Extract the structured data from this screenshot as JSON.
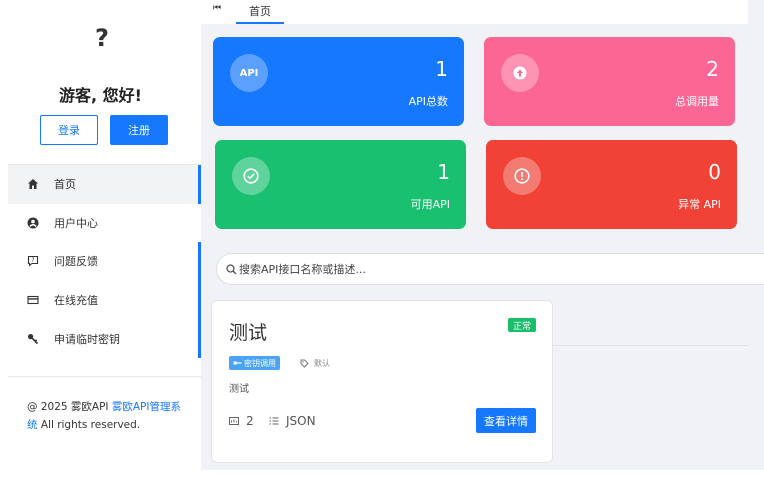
{
  "sidebar": {
    "avatar": "?",
    "greeting": "游客, 您好!",
    "login_label": "登录",
    "register_label": "注册",
    "items": [
      {
        "label": "首页",
        "icon": "home-icon"
      },
      {
        "label": "用户中心",
        "icon": "user-icon"
      },
      {
        "label": "问题反馈",
        "icon": "feedback-icon"
      },
      {
        "label": "在线充值",
        "icon": "card-icon"
      },
      {
        "label": "申请临时密钥",
        "icon": "key-icon"
      }
    ],
    "footer": {
      "prefix": "@ 2025 雾欧API ",
      "link": "雾欧API管理系统",
      "suffix": " All rights reserved."
    }
  },
  "tabs": {
    "back_icon": "⏮",
    "home": "首页"
  },
  "stats": [
    {
      "icon_text": "API",
      "value": "1",
      "label": "API总数",
      "color": "#1677ff"
    },
    {
      "icon_text": "↑",
      "value": "2",
      "label": "总调用量",
      "color": "#fc6694"
    },
    {
      "icon_text": "✓",
      "value": "1",
      "label": "可用API",
      "color": "#19c070"
    },
    {
      "icon_text": "!",
      "value": "0",
      "label": "异常 API",
      "color": "#f04236"
    }
  ],
  "search": {
    "placeholder": "搜索API接口名称或描述..."
  },
  "card": {
    "title": "测试",
    "status": "正常",
    "tag_key": "密钥调用",
    "tag_default": "默认",
    "description": "测试",
    "count": "2",
    "format": "JSON",
    "detail_label": "查看详情"
  },
  "colors": {
    "accent": "#1677ff",
    "success": "#19be6b"
  }
}
